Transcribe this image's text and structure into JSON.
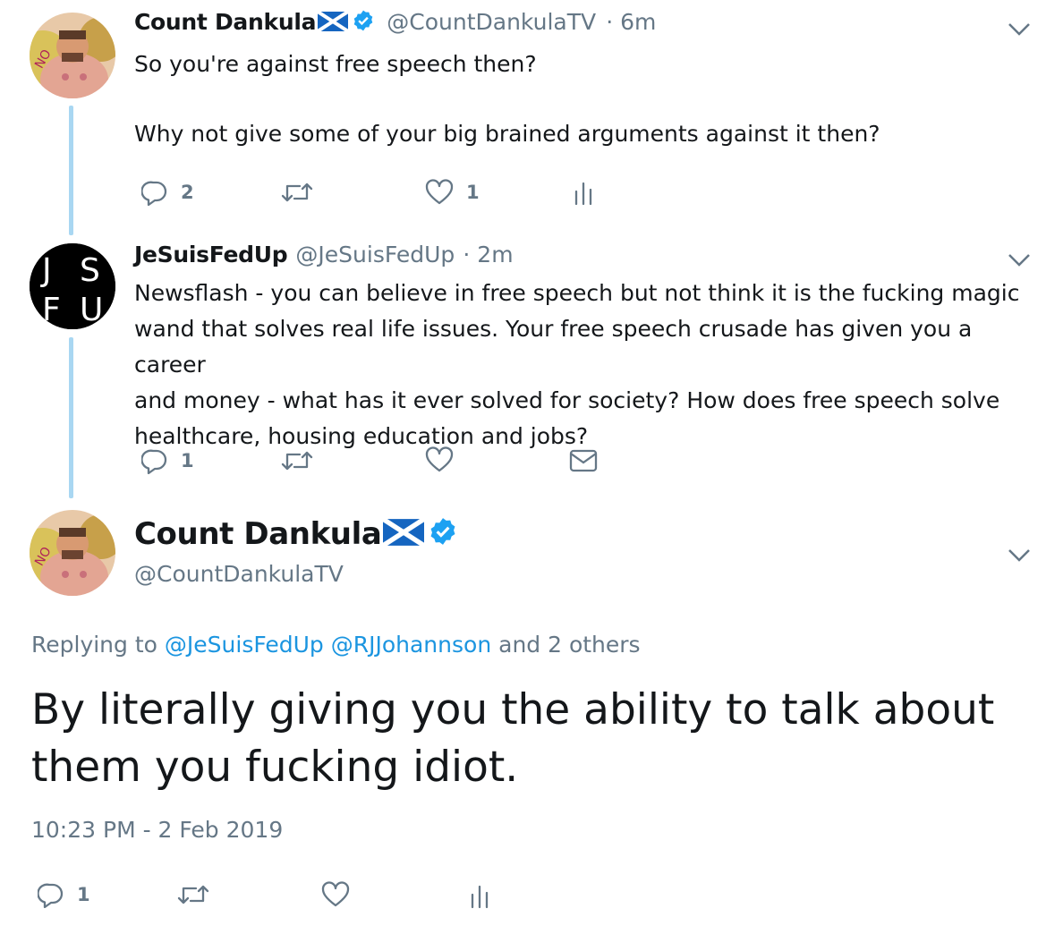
{
  "tweet1": {
    "name": "Count Dankula",
    "handle": "@CountDankulaTV",
    "time": "· 6m",
    "line1": "So you're against free speech then?",
    "line2": "Why not give some of your big brained arguments against it then?",
    "replies": "2",
    "likes": "1"
  },
  "tweet2": {
    "name": "JeSuisFedUp",
    "handle": "@JeSuisFedUp",
    "time": "· 2m",
    "avatar_letters": [
      "J",
      "S",
      "F",
      "U"
    ],
    "lines": [
      "Newsflash - you can believe in free speech but not think it is the fucking magic",
      "wand that solves real life issues. Your free speech crusade has given you a career",
      "and money - what has it ever solved for society? How does free speech solve",
      "healthcare, housing education and jobs?"
    ],
    "replies": "1"
  },
  "main": {
    "name": "Count Dankula",
    "handle": "@CountDankulaTV",
    "replying_prefix": "Replying to",
    "reply_user1": "@JeSuisFedUp",
    "reply_user2": "@RJJohannson",
    "reply_suffix": "and 2 others",
    "text_line1": "By literally giving you the ability to talk about",
    "text_line2": "them you fucking idiot.",
    "timestamp": "10:23 PM - 2 Feb 2019",
    "replies": "1"
  },
  "colors": {
    "accent": "#1da1f2",
    "thread_line": "#a9d7f2",
    "muted": "#657786",
    "text": "#14171a"
  },
  "icons": [
    "reply-icon",
    "retweet-icon",
    "like-icon",
    "analytics-icon",
    "dm-icon",
    "chevron-down-icon",
    "verified-icon",
    "scotland-flag-icon"
  ]
}
